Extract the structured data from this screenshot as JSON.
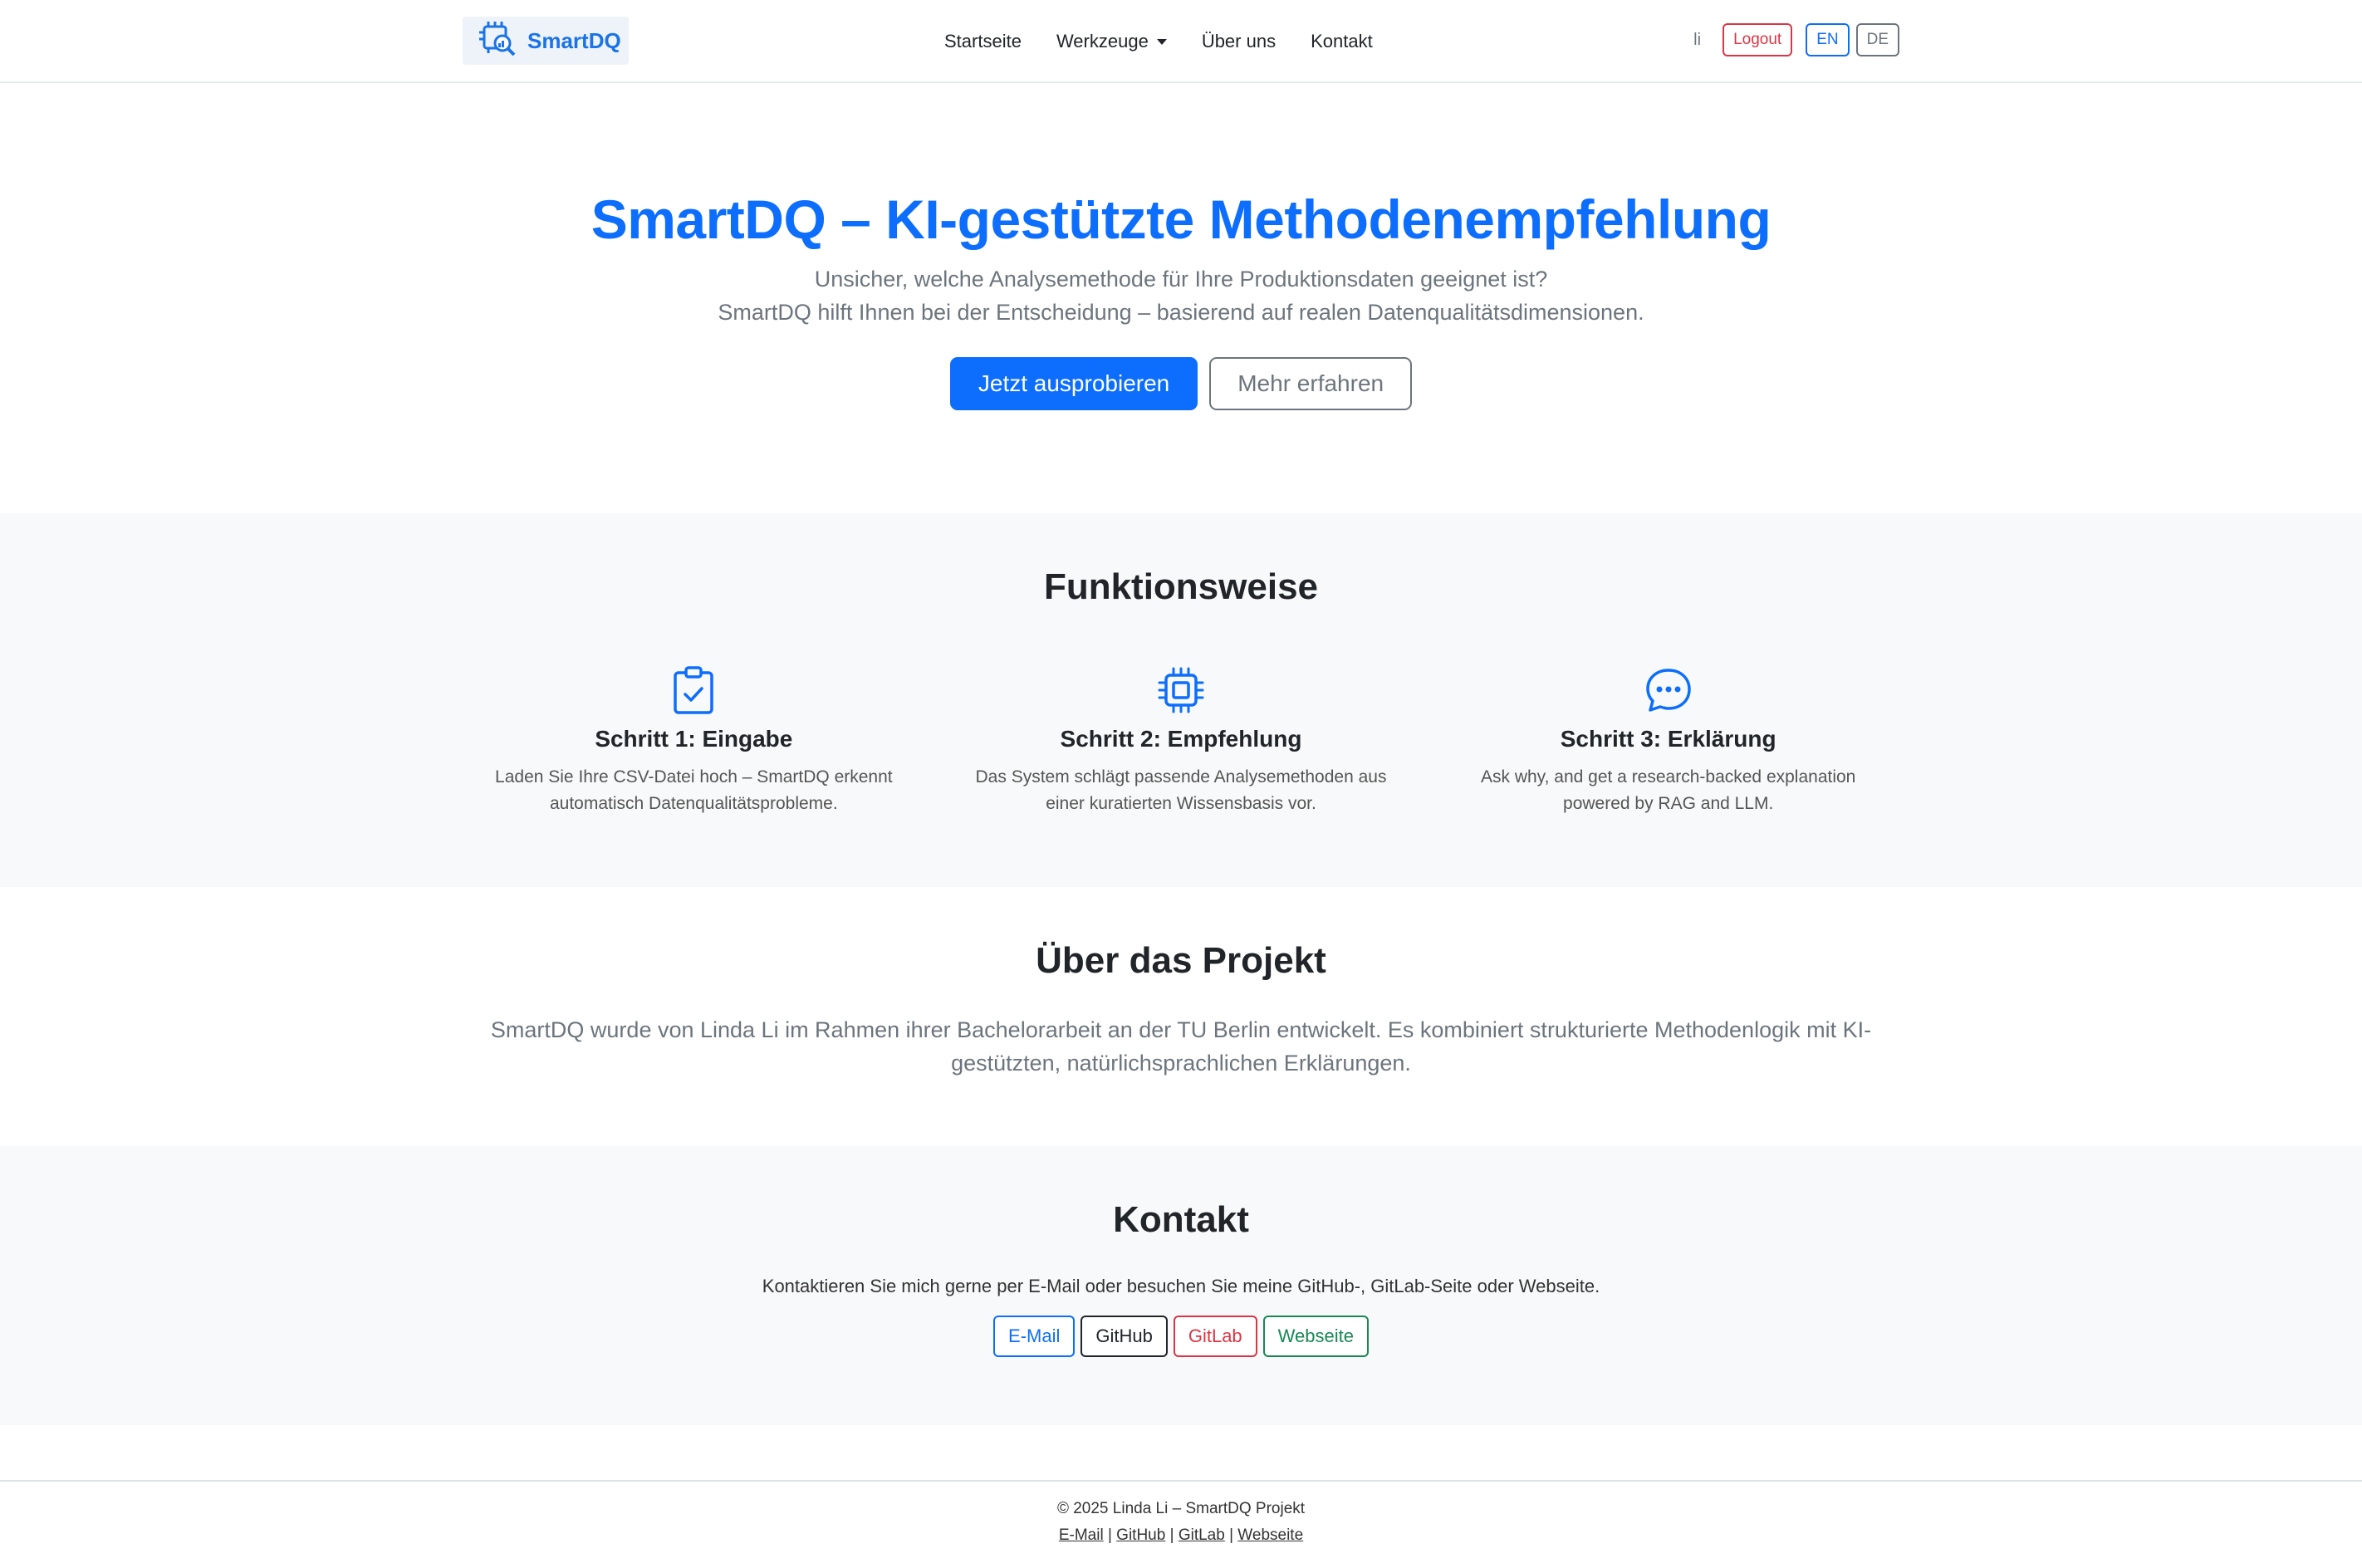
{
  "nav": {
    "logo_text": "SmartDQ",
    "links": [
      "Startseite",
      "Werkzeuge",
      "Über uns",
      "Kontakt"
    ],
    "user": "li",
    "logout": "Logout",
    "lang_en": "EN",
    "lang_de": "DE"
  },
  "hero": {
    "title": "SmartDQ – KI-gestützte Methodenempfehlung",
    "line1": "Unsicher, welche Analysemethode für Ihre Produktionsdaten geeignet ist?",
    "line2": "SmartDQ hilft Ihnen bei der Entscheidung – basierend auf realen Datenqualitätsdimensionen.",
    "btn_primary": "Jetzt ausprobieren",
    "btn_secondary": "Mehr erfahren"
  },
  "features": {
    "title": "Funktionsweise",
    "items": [
      {
        "title": "Schritt 1: Eingabe",
        "line1": "Laden Sie Ihre CSV-Datei hoch – SmartDQ erkennt",
        "line2": "automatisch Datenqualitätsprobleme.",
        "icon": "clipboard-check-icon"
      },
      {
        "title": "Schritt 2: Empfehlung",
        "line1": "Das System schlägt passende Analysemethoden aus",
        "line2": "einer kuratierten Wissensbasis vor.",
        "icon": "cpu-icon"
      },
      {
        "title": "Schritt 3: Erklärung",
        "line1": "Ask why, and get a research-backed explanation",
        "line2": "powered by RAG and LLM.",
        "icon": "chat-dots-icon"
      }
    ],
    "accent": "#0d6efd"
  },
  "about": {
    "title": "Über das Projekt",
    "text": "SmartDQ wurde von Linda Li im Rahmen ihrer Bachelorarbeit an der TU Berlin entwickelt. Es kombiniert strukturierte Methodenlogik mit KI-gestützten, natürlichsprachlichen Erklärungen."
  },
  "contact": {
    "title": "Kontakt",
    "text": "Kontaktieren Sie mich gerne per E-Mail oder besuchen Sie meine GitHub-, GitLab-Seite oder Webseite.",
    "buttons": [
      "E-Mail",
      "GitHub",
      "GitLab",
      "Webseite"
    ]
  },
  "footer": {
    "copyright": "© 2025 Linda Li – SmartDQ Projekt",
    "links": [
      "E-Mail",
      "GitHub",
      "GitLab",
      "Webseite"
    ],
    "separator": "|"
  }
}
